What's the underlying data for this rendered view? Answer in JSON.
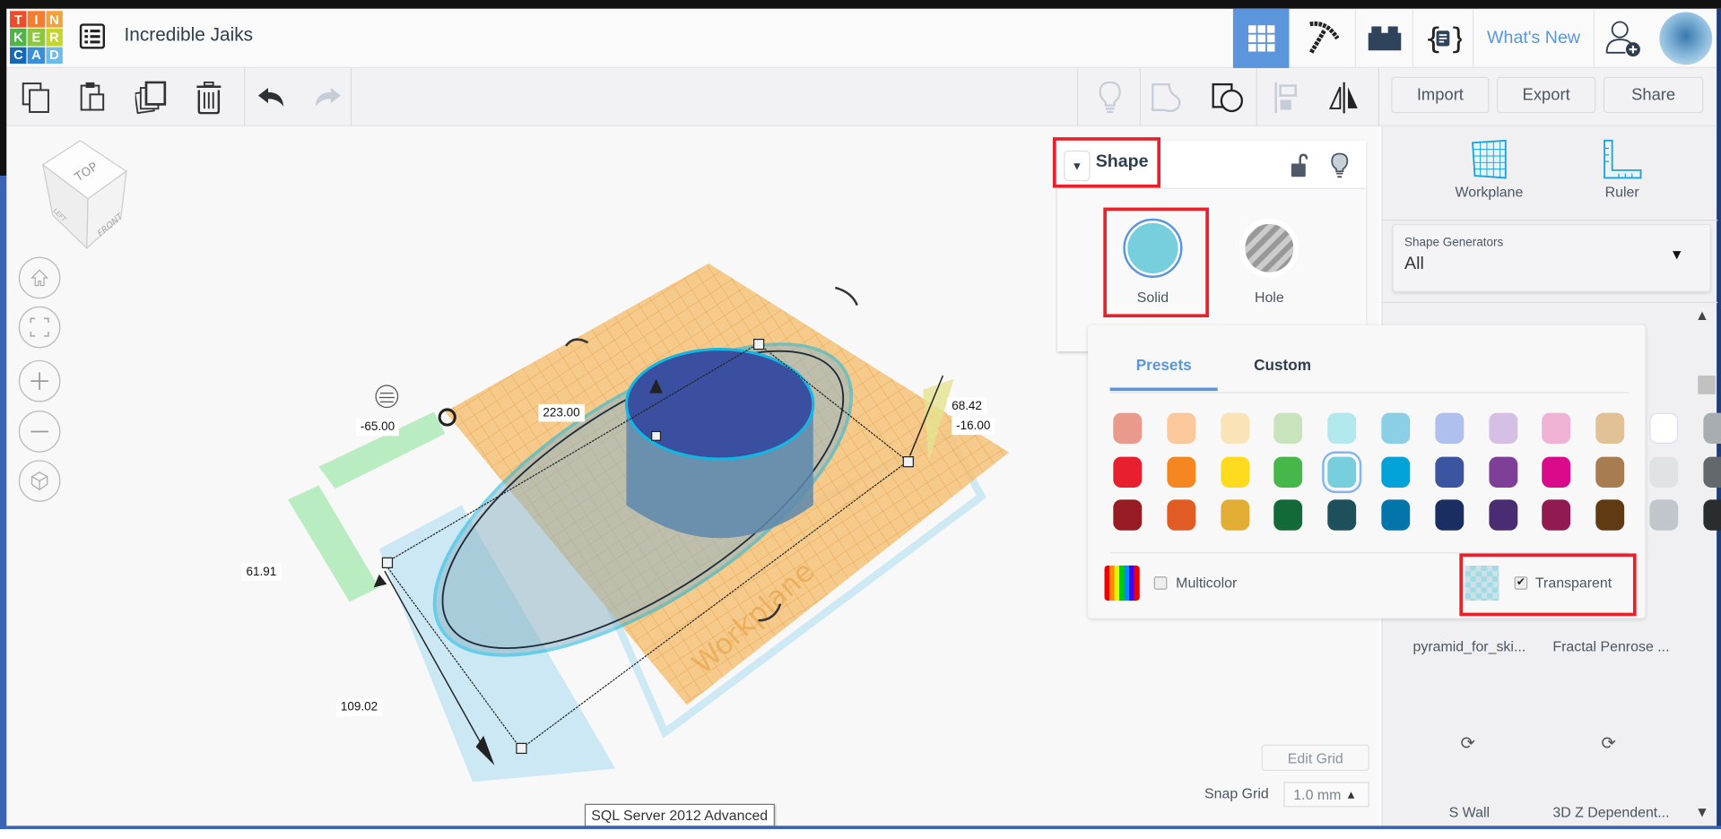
{
  "header": {
    "logo_letters": [
      "T",
      "I",
      "N",
      "K",
      "E",
      "R",
      "C",
      "A",
      "D"
    ],
    "logo_colors": [
      "#ee4b2b",
      "#f47d31",
      "#f5a13b",
      "#4fb348",
      "#8dc63f",
      "#c5d52e",
      "#1668b4",
      "#3a8fd6",
      "#6ebbe6"
    ],
    "title": "Incredible Jaiks",
    "whats_new": "What's New",
    "active_view_color": "#5b95dc"
  },
  "toolbar": {
    "import": "Import",
    "export": "Export",
    "share": "Share"
  },
  "viewcube": {
    "top": "TOP",
    "left": "LEFT",
    "front": "FRONT"
  },
  "dimensions": {
    "length": "223.00",
    "x_offset": "-65.00",
    "height": "68.42",
    "z_offset": "-16.00",
    "y_offset": "61.91",
    "width": "109.02"
  },
  "workplane_label": "Workplane",
  "shape_panel": {
    "title": "Shape",
    "solid": "Solid",
    "hole": "Hole",
    "solid_color": "#77cfdd"
  },
  "color_popup": {
    "tabs": [
      "Presets",
      "Custom"
    ],
    "active_tab": "Presets",
    "swatches": [
      [
        "#e99a8c",
        "#fbc89b",
        "#fae4b7",
        "#c9e3bd",
        "#b2e9ef",
        "#8bcfe7",
        "#afbfee",
        "#d5bfe5",
        "#efb2d4",
        "#e1c196",
        "#ffffff",
        "#a8adb1"
      ],
      [
        "#e81f2f",
        "#f68622",
        "#fedb1e",
        "#47b74b",
        "#77cfdd",
        "#00a2d8",
        "#3b55a0",
        "#7f3f98",
        "#d90b8a",
        "#a87c51",
        "#dfe3e6",
        "#63686d"
      ],
      [
        "#961b22",
        "#e15c25",
        "#e1ad35",
        "#136937",
        "#1d505b",
        "#0375aa",
        "#1b2e62",
        "#4a2c73",
        "#921a52",
        "#5f3a13",
        "#c0c6cb",
        "#2a2d30"
      ]
    ],
    "selected": "#77cfdd",
    "multicolor": "Multicolor",
    "multicolor_checked": false,
    "transparent": "Transparent",
    "transparent_checked": true
  },
  "grid": {
    "edit_grid": "Edit Grid",
    "snap_grid_label": "Snap Grid",
    "snap_grid_value": "1.0 mm"
  },
  "tooltip": "SQL Server 2012 Advanced",
  "sidebar": {
    "workplane": "Workplane",
    "ruler": "Ruler",
    "generators_label": "Shape Generators",
    "generators_value": "All",
    "items": [
      "pyramid_for_ski...",
      "Fractal Penrose ...",
      "S Wall",
      "3D Z Dependent..."
    ]
  }
}
